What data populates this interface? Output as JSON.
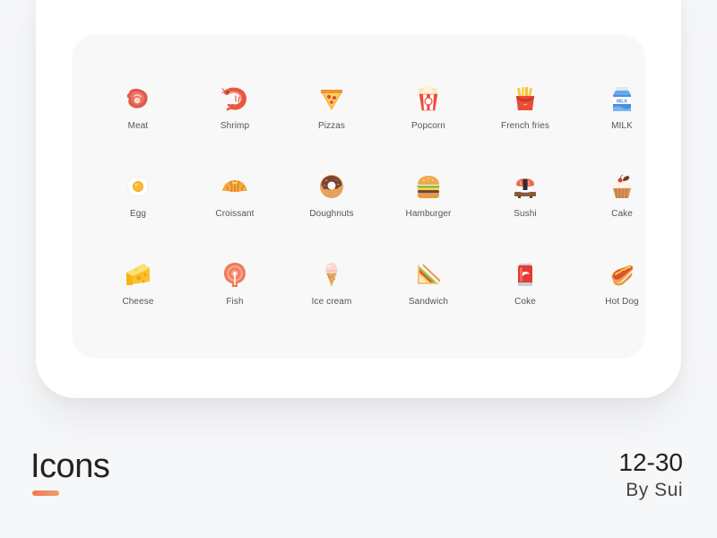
{
  "title": "Icons",
  "date": "12-30",
  "author": "By Sui",
  "accent_color": "#f07a55",
  "icons": [
    {
      "label": "Meat",
      "icon": "meat-icon"
    },
    {
      "label": "Shrimp",
      "icon": "shrimp-icon"
    },
    {
      "label": "Pizzas",
      "icon": "pizza-icon"
    },
    {
      "label": "Popcorn",
      "icon": "popcorn-icon"
    },
    {
      "label": "French fries",
      "icon": "french-fries-icon"
    },
    {
      "label": "MILK",
      "icon": "milk-icon"
    },
    {
      "label": "Egg",
      "icon": "egg-icon"
    },
    {
      "label": "Croissant",
      "icon": "croissant-icon"
    },
    {
      "label": "Doughnuts",
      "icon": "doughnut-icon"
    },
    {
      "label": "Hamburger",
      "icon": "hamburger-icon"
    },
    {
      "label": "Sushi",
      "icon": "sushi-icon"
    },
    {
      "label": "Cake",
      "icon": "cake-icon"
    },
    {
      "label": "Cheese",
      "icon": "cheese-icon"
    },
    {
      "label": "Fish",
      "icon": "fish-icon"
    },
    {
      "label": "Ice cream",
      "icon": "ice-cream-icon"
    },
    {
      "label": "Sandwich",
      "icon": "sandwich-icon"
    },
    {
      "label": "Coke",
      "icon": "coke-icon"
    },
    {
      "label": "Hot Dog",
      "icon": "hot-dog-icon"
    }
  ]
}
